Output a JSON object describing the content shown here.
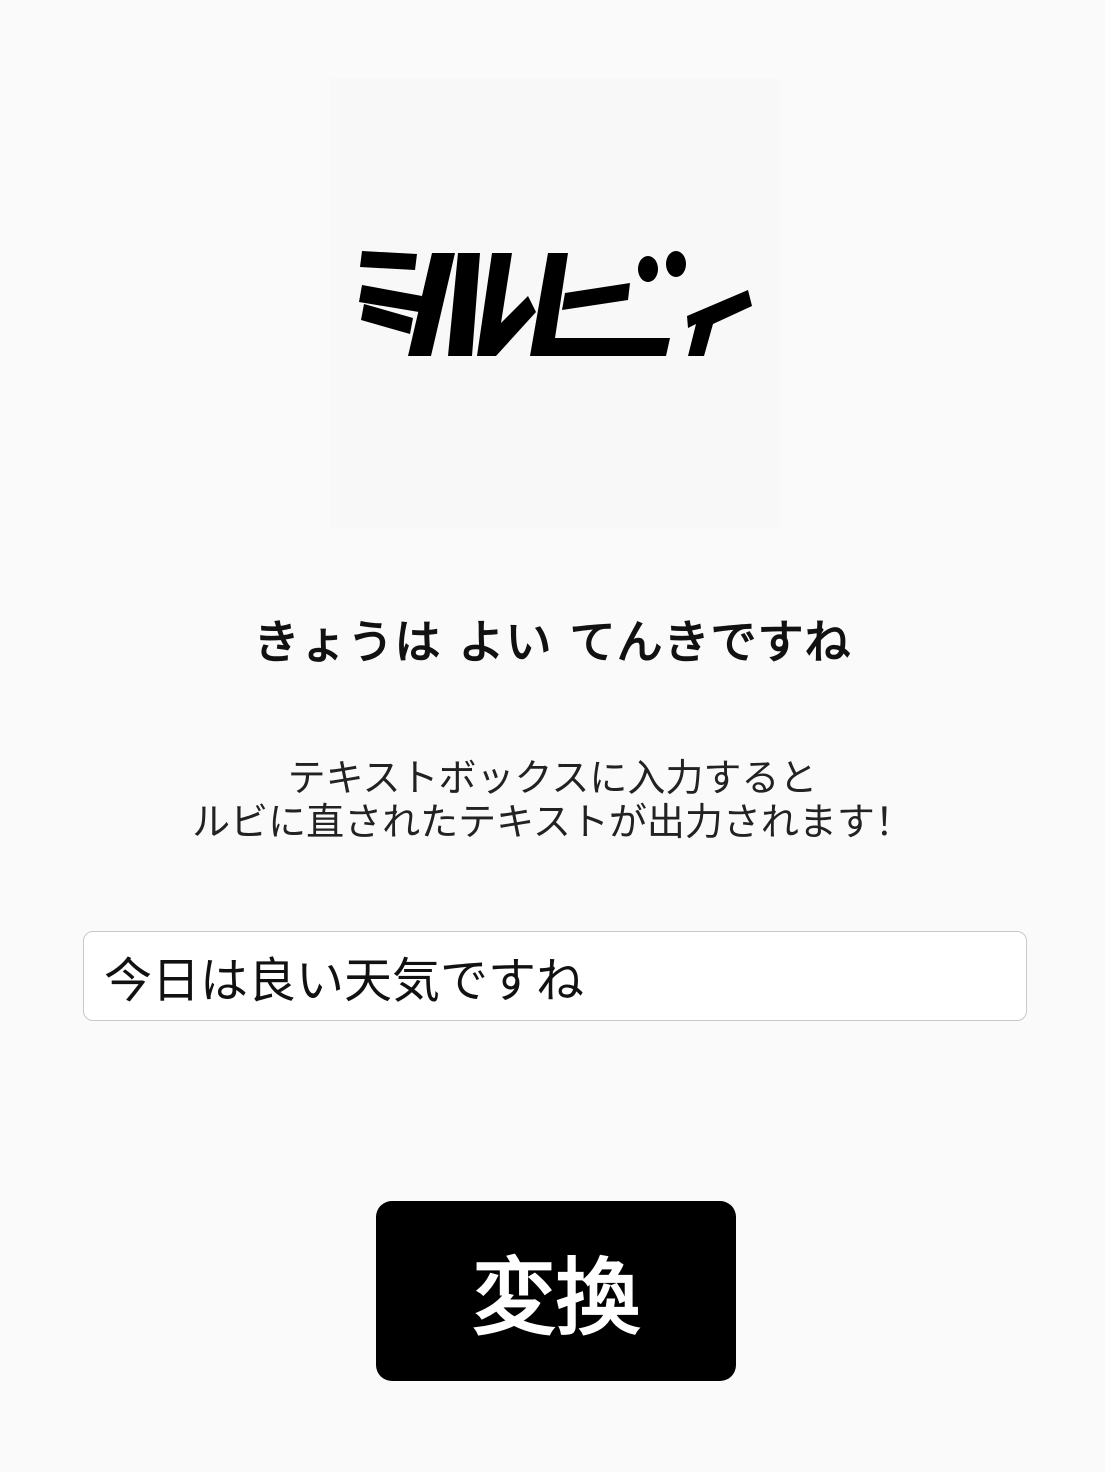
{
  "app": {
    "logo_text": "シルビィ",
    "logo_icon": "sirubi-logo"
  },
  "output": {
    "text": "きょうは よい てんきですね"
  },
  "instructions": {
    "line1": "テキストボックスに入力すると",
    "line2": "ルビに直されたテキストが出力されます！"
  },
  "input": {
    "value": "今日は良い天気ですね",
    "placeholder": ""
  },
  "actions": {
    "convert_label": "変換"
  },
  "colors": {
    "background": "#fafafa",
    "button": "#000000",
    "button_text": "#ffffff",
    "text": "#111111"
  }
}
